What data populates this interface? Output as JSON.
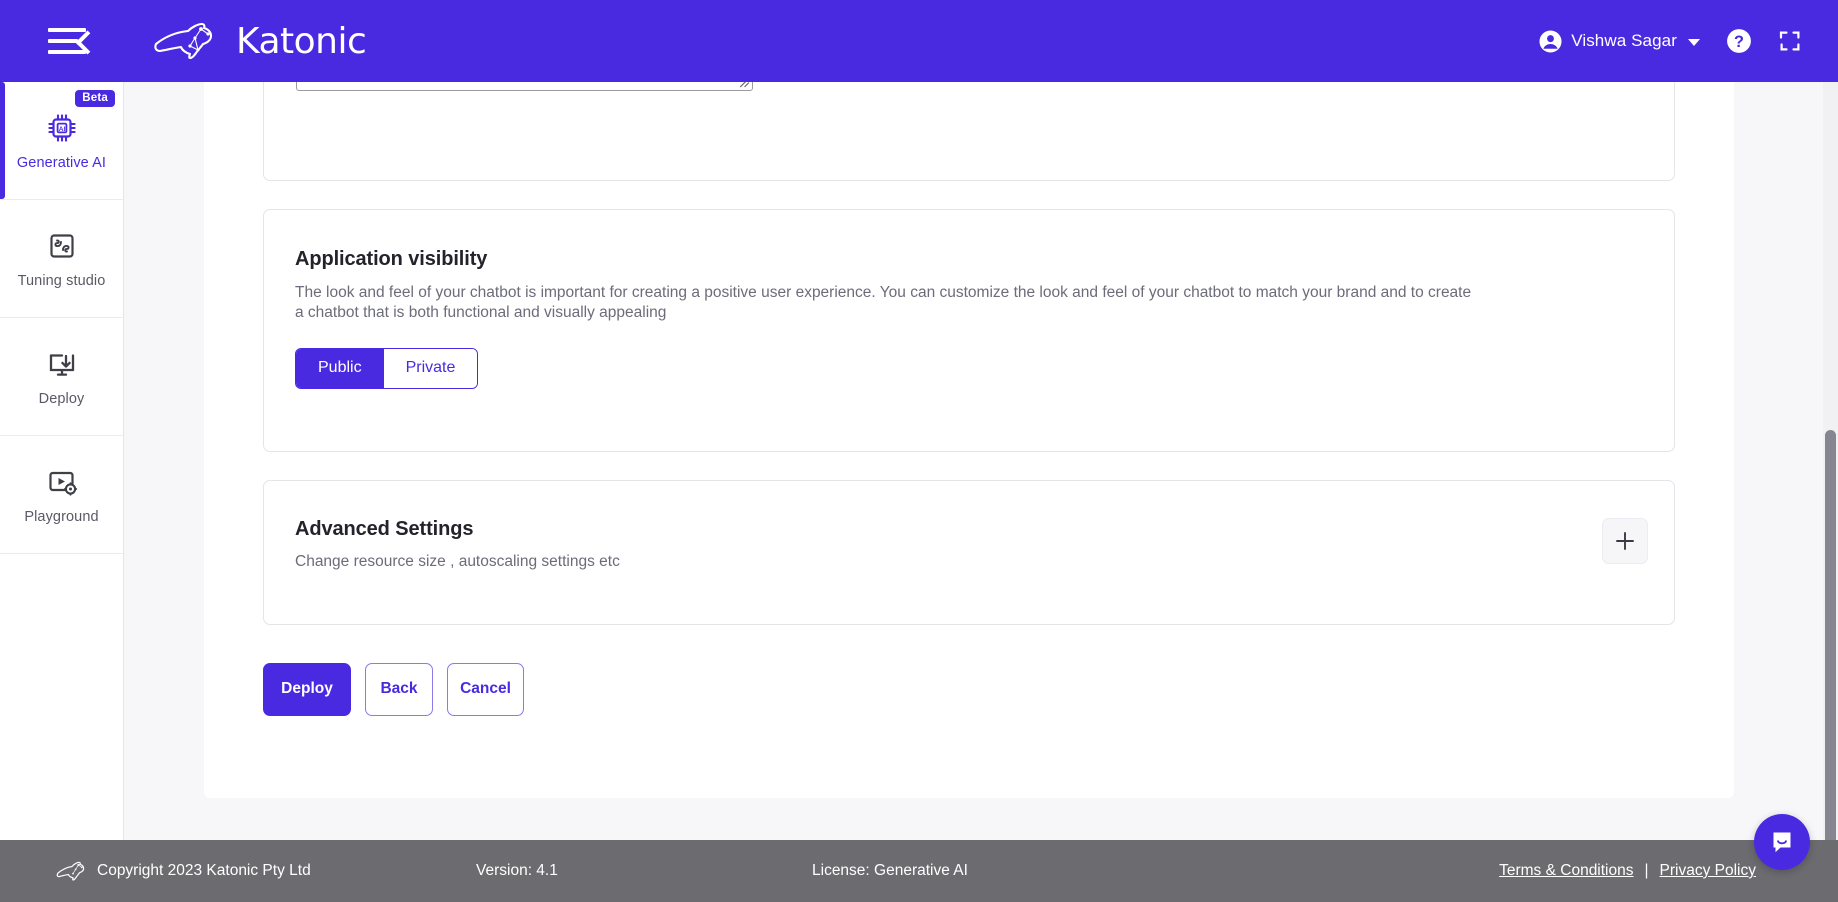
{
  "header": {
    "brand_name": "Katonic",
    "menu_icon": "hamburger-collapse-icon",
    "user_name": "Vishwa Sagar",
    "help_icon": "help-circle-icon",
    "fullscreen_icon": "fullscreen-expand-icon"
  },
  "sidebar": {
    "items": [
      {
        "label": "Generative AI",
        "icon": "ai-chip-icon",
        "badge": "Beta",
        "active": true
      },
      {
        "label": "Tuning studio",
        "icon": "puzzle-icon",
        "badge": "",
        "active": false
      },
      {
        "label": "Deploy",
        "icon": "monitor-download-icon",
        "badge": "",
        "active": false
      },
      {
        "label": "Playground",
        "icon": "video-settings-icon",
        "badge": "",
        "active": false
      }
    ]
  },
  "main": {
    "visibility": {
      "title": "Application visibility",
      "description": "The look and feel of your chatbot is important for creating a positive user experience. You can customize the look and feel of your chatbot to match your brand and to create a chatbot that is both functional and visually appealing",
      "options": [
        "Public",
        "Private"
      ],
      "selected": "Public"
    },
    "advanced": {
      "title": "Advanced Settings",
      "description": "Change resource size , autoscaling settings etc",
      "expand_icon": "plus-icon"
    },
    "actions": {
      "deploy": "Deploy",
      "back": "Back",
      "cancel": "Cancel"
    }
  },
  "footer": {
    "copyright": "Copyright 2023 Katonic Pty Ltd",
    "version": "Version: 4.1",
    "license": "License: Generative AI",
    "terms": "Terms & Conditions",
    "separator": "|",
    "privacy": "Privacy Policy",
    "logo_icon": "kangaroo-logo-icon"
  },
  "chat": {
    "icon": "chat-bubble-smile-icon"
  },
  "colors": {
    "brand_purple": "#4a2ae0",
    "footer_gray": "#6b6b70",
    "page_bg": "#f7f7f9",
    "text_dark": "#23232b",
    "text_muted": "#6c6c7a"
  }
}
